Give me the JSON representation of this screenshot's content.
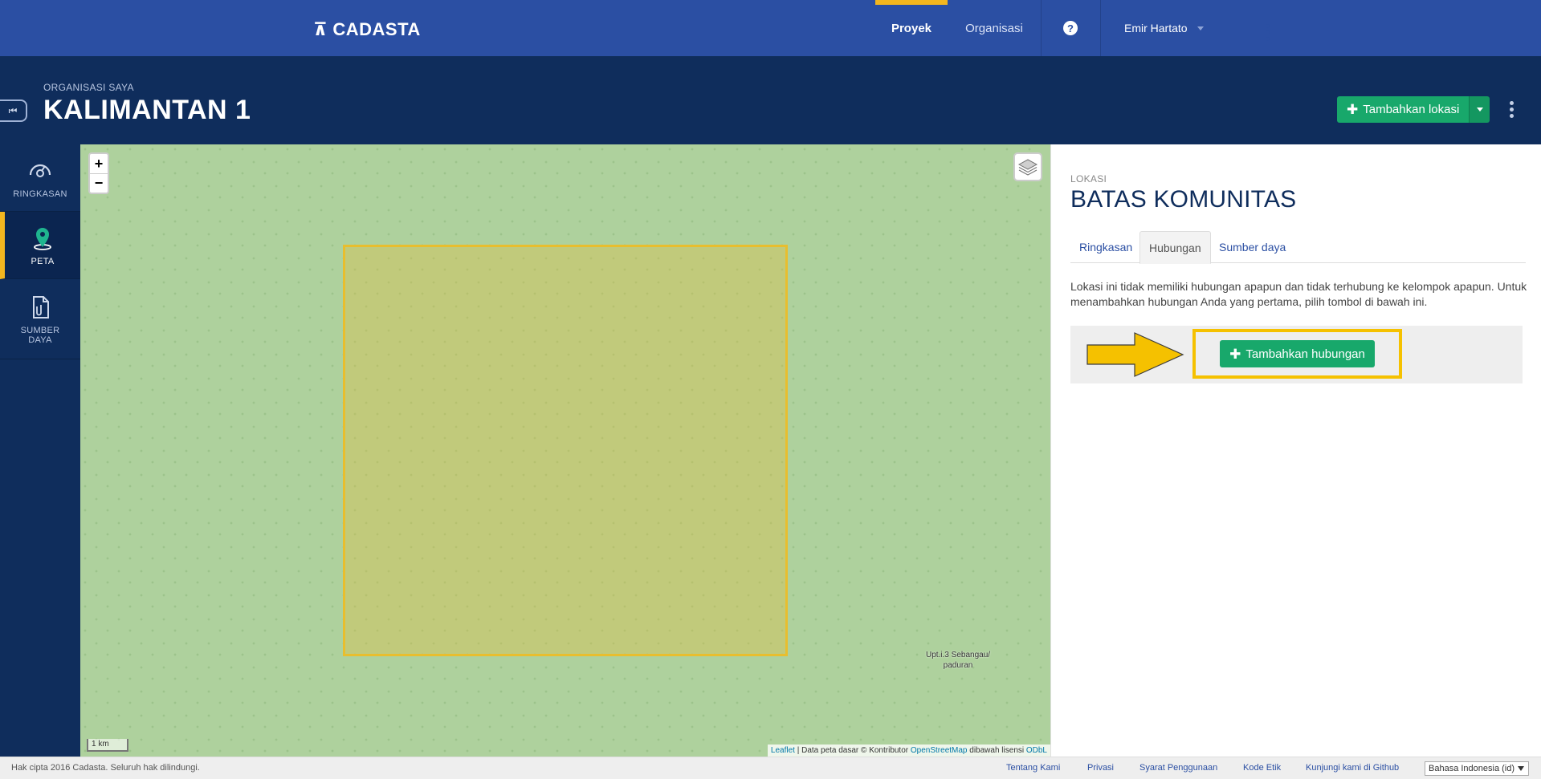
{
  "topnav": {
    "brand": "CADASTA",
    "brand_mark": "⊼",
    "items": [
      {
        "label": "Proyek",
        "active": true
      },
      {
        "label": "Organisasi",
        "active": false
      }
    ],
    "help_glyph": "?",
    "user_name": "Emir Hartato"
  },
  "header": {
    "org_label": "ORGANISASI SAYA",
    "project_title": "KALIMANTAN 1",
    "add_location_label": "Tambahkan lokasi",
    "collapse_glyph": "⏮"
  },
  "sidebar": {
    "items": [
      {
        "label": "RINGKASAN",
        "icon": "dashboard-icon",
        "active": false
      },
      {
        "label": "PETA",
        "icon": "map-pin-icon",
        "active": true
      },
      {
        "label_line1": "SUMBER",
        "label_line2": "DAYA",
        "icon": "document-attachment-icon",
        "active": false
      }
    ]
  },
  "map": {
    "zoom_in": "+",
    "zoom_out": "−",
    "place_label_line1": "Upt.i.3 Sebangau/",
    "place_label_line2": "paduran",
    "scale_label": "1 km",
    "attribution": {
      "leaflet": "Leaflet",
      "text1": " | Data peta dasar © Kontributor ",
      "osm": "OpenStreetMap",
      "text2": " dibawah lisensi ",
      "odbl": "ODbL"
    }
  },
  "panel": {
    "label": "LOKASI",
    "title": "BATAS KOMUNITAS",
    "tabs": [
      {
        "label": "Ringkasan",
        "active": false
      },
      {
        "label": "Hubungan",
        "active": true
      },
      {
        "label": "Sumber daya",
        "active": false
      }
    ],
    "message": "Lokasi ini tidak memiliki hubungan apapun dan tidak terhubung ke kelompok apapun. Untuk menambahkan hubungan Anda yang pertama, pilih tombol di bawah ini.",
    "add_relationship_label": "Tambahkan hubungan"
  },
  "footer": {
    "copyright": "Hak cipta 2016 Cadasta. Seluruh hak dilindungi.",
    "links": [
      "Tentang Kami",
      "Privasi",
      "Syarat Penggunaan",
      "Kode Etik",
      "Kunjungi kami di Github"
    ],
    "language": "Bahasa Indonesia (id)"
  },
  "colors": {
    "nav_blue": "#2b4fa3",
    "header_navy": "#0f2d5c",
    "accent_yellow": "#f3b61f",
    "button_green": "#18a86b",
    "map_green": "#aed19d"
  }
}
